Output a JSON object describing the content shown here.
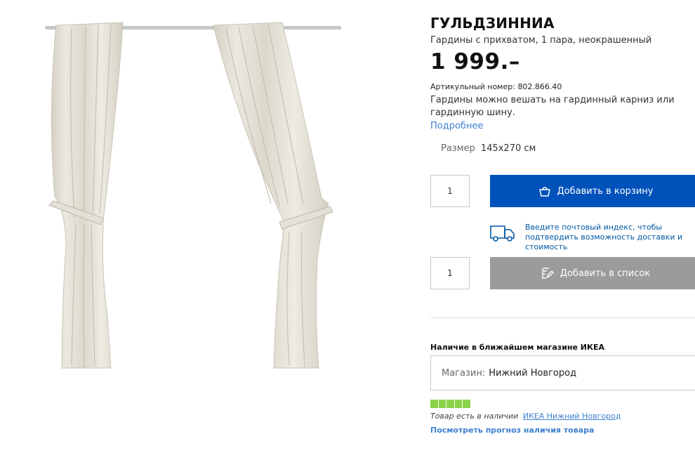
{
  "product": {
    "name": "ГУЛЬДЗИННИА",
    "subtitle": "Гардины с прихватом, 1 пара, неокрашенный",
    "price": "1 999.–",
    "article_label": "Артикульный номер:",
    "article_number": "802.866.40",
    "description": "Гардины можно вешать на гардинный карниз или гардинную шину.",
    "more_link": "Подробнее",
    "image_icon": "curtains-photo"
  },
  "size": {
    "label": "Размер",
    "value": "145x270 см"
  },
  "cart": {
    "quantity": "1",
    "button_label": "Добавить в корзину",
    "icon": "basket-icon",
    "color": "#0051ba"
  },
  "delivery": {
    "icon": "truck-icon",
    "text": "Введите почтовый индекс, чтобы подтвердить возможность доставки и стоимость"
  },
  "list": {
    "quantity": "1",
    "button_label": "Добавить в список",
    "icon": "pencil-list-icon",
    "color": "#9b9b9b"
  },
  "store": {
    "heading": "Наличие в ближайшем магазине ИКЕА",
    "select_label": "Магазин:",
    "select_value": "Нижний Новгород"
  },
  "availability": {
    "level_filled": 5,
    "level_total": 5,
    "color": "#8ad34a",
    "text": "Товар есть в наличии",
    "store_link": "ИКЕА Нижний Новгород",
    "forecast_link": "Посмотреть прогноз наличия товара"
  }
}
